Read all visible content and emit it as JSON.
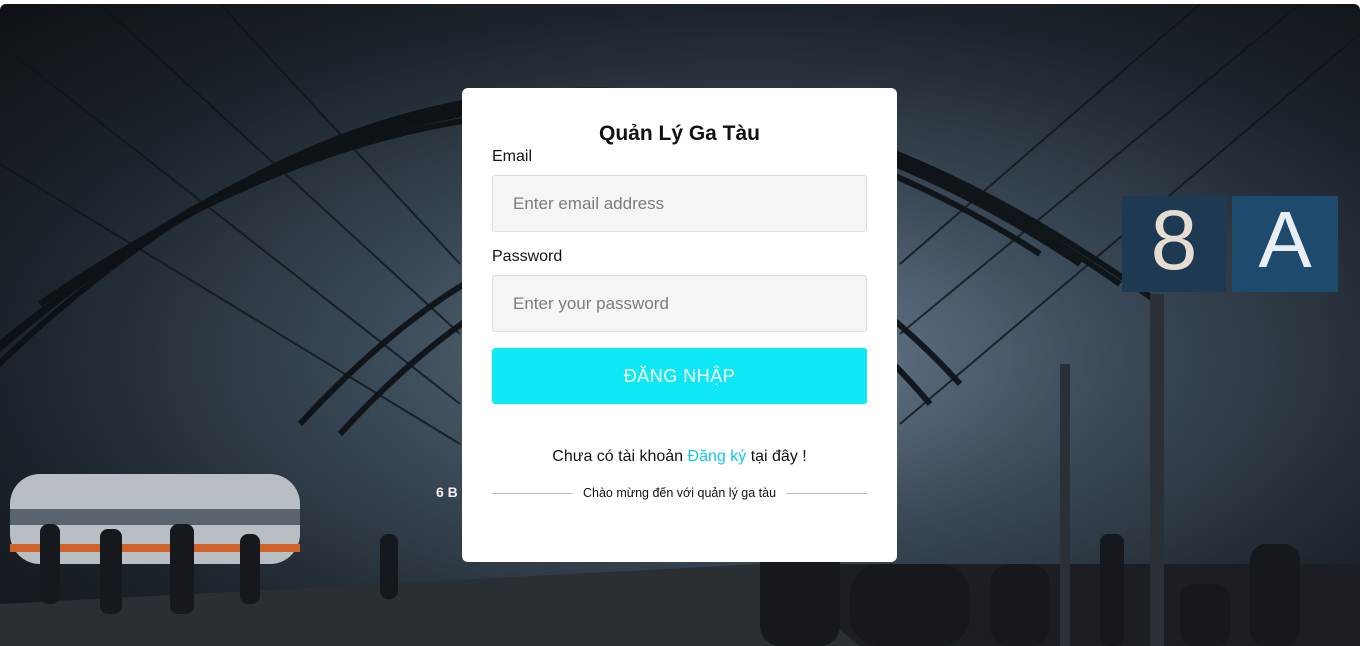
{
  "login": {
    "title": "Quản Lý Ga Tàu",
    "email_label": "Email",
    "email_placeholder": "Enter email address",
    "password_label": "Password",
    "password_placeholder": "Enter your password",
    "submit_label": "ĐĂNG NHẬP",
    "signup_prefix": "Chưa có tài khoản",
    "signup_link": "Đăng ký",
    "signup_suffix": "tại đây !",
    "welcome_text": "Chào mừng đến với quản lý ga tàu"
  },
  "background": {
    "platform_sign_number": "8",
    "platform_sign_letter": "A",
    "sign_small": "6 B",
    "accent_color": "#0ee8f6",
    "link_color": "#10c8e8"
  }
}
